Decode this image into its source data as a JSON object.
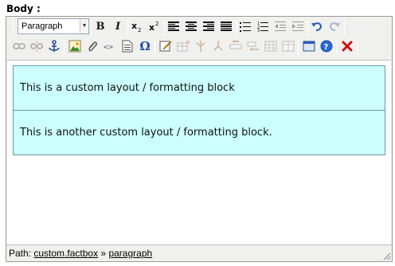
{
  "field": {
    "label": "Body :"
  },
  "toolbar": {
    "format_select": {
      "value": "Paragraph"
    },
    "bold_glyph": "B",
    "italic_glyph": "I"
  },
  "content": {
    "blocks": [
      "This is a custom layout / formatting block",
      "This is another custom layout / formatting block."
    ]
  },
  "statusbar": {
    "path_label": "Path:",
    "crumbs": [
      "custom.factbox",
      "paragraph"
    ],
    "separator": "»"
  },
  "colors": {
    "block_background": "#ccffff",
    "block_border": "#6a9aa8",
    "toolbar_background": "#f0f0ee",
    "delete_red": "#cc1111"
  }
}
